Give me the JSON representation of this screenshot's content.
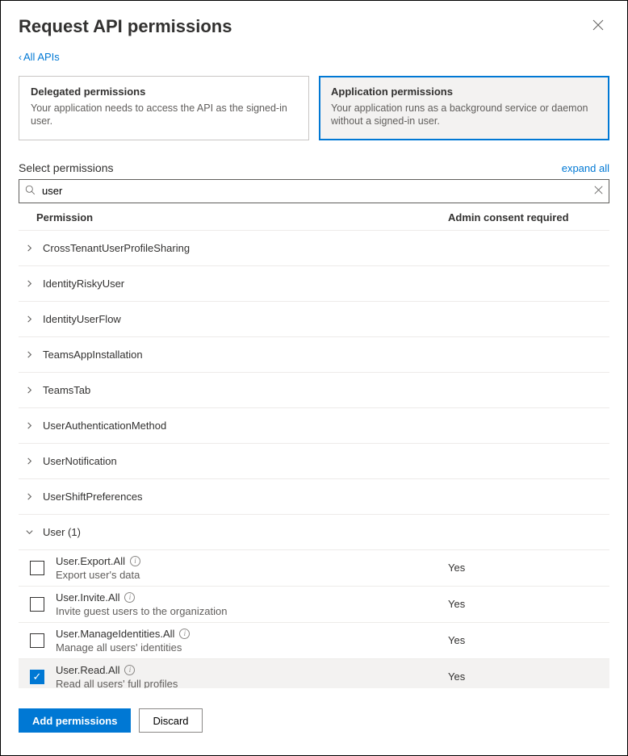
{
  "header": {
    "title": "Request API permissions"
  },
  "back_link": {
    "text": "All APIs"
  },
  "perm_types": {
    "delegated": {
      "title": "Delegated permissions",
      "desc": "Your application needs to access the API as the signed-in user."
    },
    "application": {
      "title": "Application permissions",
      "desc": "Your application runs as a background service or daemon without a signed-in user."
    }
  },
  "select_section": {
    "label": "Select permissions",
    "expand_all": "expand all"
  },
  "search": {
    "value": "user",
    "placeholder": ""
  },
  "columns": {
    "permission": "Permission",
    "consent": "Admin consent required"
  },
  "groups": [
    {
      "name": "CrossTenantUserProfileSharing",
      "expanded": false
    },
    {
      "name": "IdentityRiskyUser",
      "expanded": false
    },
    {
      "name": "IdentityUserFlow",
      "expanded": false
    },
    {
      "name": "TeamsAppInstallation",
      "expanded": false
    },
    {
      "name": "TeamsTab",
      "expanded": false
    },
    {
      "name": "UserAuthenticationMethod",
      "expanded": false
    },
    {
      "name": "UserNotification",
      "expanded": false
    },
    {
      "name": "UserShiftPreferences",
      "expanded": false
    }
  ],
  "expanded_group": {
    "label": "User (1)",
    "items": [
      {
        "name": "User.Export.All",
        "desc": "Export user's data",
        "consent": "Yes",
        "checked": false
      },
      {
        "name": "User.Invite.All",
        "desc": "Invite guest users to the organization",
        "consent": "Yes",
        "checked": false
      },
      {
        "name": "User.ManageIdentities.All",
        "desc": "Manage all users' identities",
        "consent": "Yes",
        "checked": false
      },
      {
        "name": "User.Read.All",
        "desc": "Read all users' full profiles",
        "consent": "Yes",
        "checked": true
      }
    ]
  },
  "footer": {
    "add": "Add permissions",
    "discard": "Discard"
  }
}
